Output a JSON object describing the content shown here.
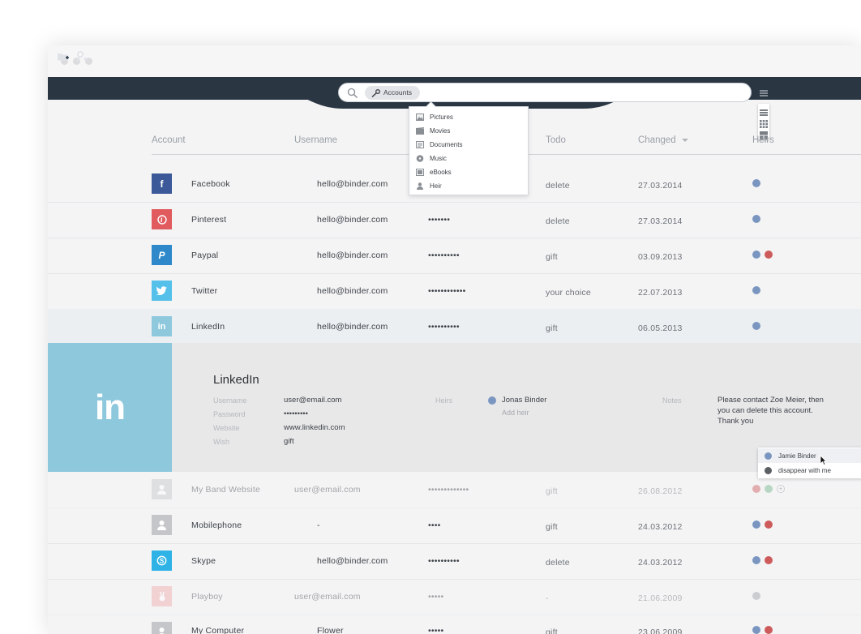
{
  "toolbar": {
    "left_icons": [
      "new-folder-icon",
      "add-key-icon"
    ],
    "search": {
      "filter_chip": "Accounts",
      "placeholder": ""
    }
  },
  "category_menu": {
    "items": [
      {
        "label": "Pictures",
        "icon": "picture-icon"
      },
      {
        "label": "Movies",
        "icon": "movie-icon"
      },
      {
        "label": "Documents",
        "icon": "document-icon"
      },
      {
        "label": "Music",
        "icon": "music-icon"
      },
      {
        "label": "eBooks",
        "icon": "ebook-icon"
      },
      {
        "label": "Heir",
        "icon": "person-icon"
      }
    ]
  },
  "table": {
    "columns": [
      "Account",
      "Username",
      "Todo",
      "Changed",
      "Heirs"
    ],
    "rows": [
      {
        "account": "Facebook",
        "username": "hello@binder.com",
        "password": "",
        "todo": "delete",
        "changed": "27.03.2014"
      },
      {
        "account": "Pinterest",
        "username": "hello@binder.com",
        "password": "•••••••",
        "todo": "delete",
        "changed": "27.03.2014"
      },
      {
        "account": "Paypal",
        "username": "hello@binder.com",
        "password": "••••••••••",
        "todo": "gift",
        "changed": "03.09.2013"
      },
      {
        "account": "Twitter",
        "username": "hello@binder.com",
        "password": "••••••••••••",
        "todo": "your choice",
        "changed": "22.07.2013"
      },
      {
        "account": "LinkedIn",
        "username": "hello@binder.com",
        "password": "••••••••••",
        "todo": "gift",
        "changed": "06.05.2013"
      },
      {
        "account": "My Band Website",
        "username": "user@email.com",
        "password": "•••••••••••••",
        "todo": "gift",
        "changed": "26.08.2012"
      },
      {
        "account": "Mobilephone",
        "username": "-",
        "password": "••••",
        "todo": "gift",
        "changed": "24.03.2012"
      },
      {
        "account": "Skype",
        "username": "hello@binder.com",
        "password": "••••••••••",
        "todo": "delete",
        "changed": "24.03.2012"
      },
      {
        "account": "Playboy",
        "username": "user@email.com",
        "password": "•••••",
        "todo": "-",
        "changed": "21.06.2009"
      },
      {
        "account": "My Computer",
        "username": "Flower",
        "password": "•••••",
        "todo": "gift",
        "changed": "23.06.2009"
      }
    ]
  },
  "detail": {
    "logo_text": "in",
    "title": "LinkedIn",
    "fields": [
      {
        "label": "Username",
        "value": "user@email.com"
      },
      {
        "label": "Password",
        "value": "•••••••••"
      },
      {
        "label": "Website",
        "value": "www.linkedin.com"
      },
      {
        "label": "Wish",
        "value": "gift"
      }
    ],
    "heirs_label": "Heirs",
    "heir_name": "Jonas Binder",
    "add_heir": "Add heir",
    "notes_label": "Notes",
    "notes_lines": [
      "Please contact Zoe Meier, then",
      "you can delete this account.",
      "Thank you"
    ]
  },
  "heir_popup": {
    "items": [
      "Jamie Binder",
      "disappear with me"
    ]
  },
  "colors": {
    "toolbar": "#2b3643",
    "facebook": "#3b5998",
    "pinterest": "#e05a5e",
    "paypal": "#2e88c9",
    "twitter": "#55c0ea",
    "linkedin": "#8ec8dc",
    "skype": "#2fb3e6",
    "heir_blue": "#7a96c0",
    "heir_red": "#cd5b5b"
  }
}
